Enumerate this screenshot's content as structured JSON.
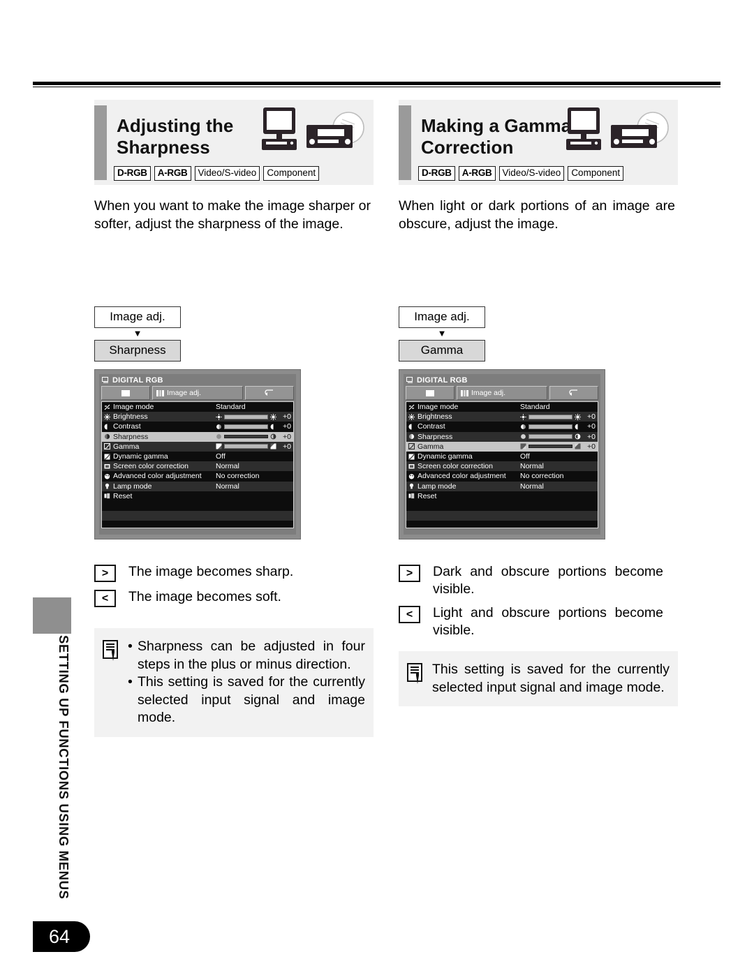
{
  "page": {
    "number": "64",
    "chapter": "SETTING UP FUNCTIONS USING MENUS"
  },
  "sections": [
    {
      "title_line1": "Adjusting the",
      "title_line2": "Sharpness",
      "tags": [
        "D-RGB",
        "A-RGB",
        "Video/S-video",
        "Component"
      ],
      "intro": "When you want to make the image sharper or softer, adjust the sharpness of the image.",
      "breadcrumb": {
        "parent": "Image adj.",
        "arrow": "▼",
        "child": "Sharpness"
      },
      "osd": {
        "title": "DIGITAL RGB",
        "tab_active_label": "Image adj.",
        "rows": [
          {
            "label": "Image mode",
            "value": "Standard",
            "type": "value"
          },
          {
            "label": "Brightness",
            "value": "+0",
            "type": "slider"
          },
          {
            "label": "Contrast",
            "value": "+0",
            "type": "slider"
          },
          {
            "label": "Sharpness",
            "value": "+0",
            "type": "slider"
          },
          {
            "label": "Gamma",
            "value": "+0",
            "type": "slider"
          },
          {
            "label": "Dynamic gamma",
            "value": "Off",
            "type": "value"
          },
          {
            "label": "Screen color correction",
            "value": "Normal",
            "type": "value"
          },
          {
            "label": "Advanced color adjustment",
            "value": "No correction",
            "type": "value"
          },
          {
            "label": "Lamp mode",
            "value": "Normal",
            "type": "value"
          },
          {
            "label": "Reset",
            "value": "",
            "type": "value"
          }
        ],
        "selected_row": "Sharpness"
      },
      "keys": [
        {
          "key": ">",
          "text": "The image becomes sharp."
        },
        {
          "key": "<",
          "text": "The image becomes soft."
        }
      ],
      "note_bullets": [
        "Sharpness can be adjusted in four steps in the plus or minus direction.",
        "This setting is saved for the currently selected input signal and image mode."
      ]
    },
    {
      "title_line1": "Making a Gamma",
      "title_line2": "Correction",
      "tags": [
        "D-RGB",
        "A-RGB",
        "Video/S-video",
        "Component"
      ],
      "intro": "When light or dark portions of an image are obscure, adjust the image.",
      "breadcrumb": {
        "parent": "Image adj.",
        "arrow": "▼",
        "child": "Gamma"
      },
      "osd": {
        "title": "DIGITAL RGB",
        "tab_active_label": "Image adj.",
        "rows": [
          {
            "label": "Image mode",
            "value": "Standard",
            "type": "value"
          },
          {
            "label": "Brightness",
            "value": "+0",
            "type": "slider"
          },
          {
            "label": "Contrast",
            "value": "+0",
            "type": "slider"
          },
          {
            "label": "Sharpness",
            "value": "+0",
            "type": "slider"
          },
          {
            "label": "Gamma",
            "value": "+0",
            "type": "slider"
          },
          {
            "label": "Dynamic gamma",
            "value": "Off",
            "type": "value"
          },
          {
            "label": "Screen color correction",
            "value": "Normal",
            "type": "value"
          },
          {
            "label": "Advanced color adjustment",
            "value": "No correction",
            "type": "value"
          },
          {
            "label": "Lamp mode",
            "value": "Normal",
            "type": "value"
          },
          {
            "label": "Reset",
            "value": "",
            "type": "value"
          }
        ],
        "selected_row": "Gamma"
      },
      "keys": [
        {
          "key": ">",
          "text": "Dark and obscure portions become visible."
        },
        {
          "key": "<",
          "text": "Light  and obscure portions become visible."
        }
      ],
      "note_text": "This setting is saved for the currently selected input signal and image mode."
    }
  ],
  "icons": {
    "monitor": "computer-monitor-icon",
    "player": "av-player-icon",
    "note": "memo-pen-icon"
  },
  "colors": {
    "header_bg": "#f0f0f0",
    "header_bar": "#9a9a9a",
    "note_bg": "#f2f2f2",
    "osd_frame": "#8c8c8c",
    "osd_list_bg": "#0d0d0d",
    "osd_selected": "#c6c6c6",
    "page_tab": "#000000"
  }
}
